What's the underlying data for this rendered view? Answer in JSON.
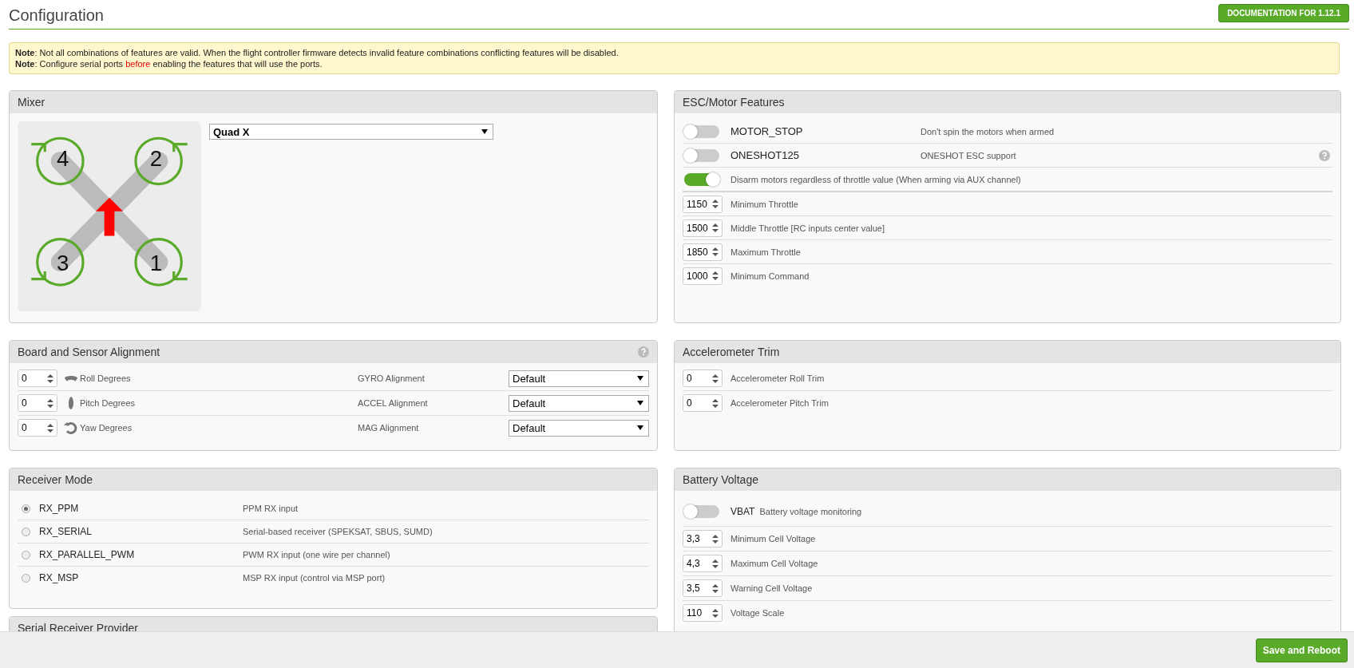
{
  "header": {
    "title": "Configuration",
    "doc_button": "DOCUMENTATION FOR 1.12.1"
  },
  "notes": [
    {
      "segments": [
        {
          "kind": "plain",
          "text": "**Note**: Not all combinations of features are valid. When the flight controller firmware detects invalid feature combinations conflicting features will be disabled."
        }
      ]
    },
    {
      "segments": [
        {
          "kind": "plain",
          "text": "**Note**: Configure serial ports "
        },
        {
          "kind": "warning",
          "text": "before"
        },
        {
          "kind": "plain",
          "text": " enabling the features that will use the ports."
        }
      ]
    }
  ],
  "mixer": {
    "title": "Mixer",
    "type": "Quad X",
    "motors": [
      "4",
      "2",
      "3",
      "1"
    ]
  },
  "esc": {
    "title": "ESC/Motor Features",
    "items": [
      {
        "kind": "toggle",
        "on": false,
        "name": "MOTOR_STOP",
        "description": "Don't spin the motors when armed",
        "help": false
      },
      {
        "kind": "toggle",
        "on": false,
        "name": "ONESHOT125",
        "description": "ONESHOT ESC support",
        "help": true
      },
      {
        "kind": "toggle",
        "on": true,
        "description": "Disarm motors regardless of throttle value (When arming via AUX channel)",
        "help": false
      },
      {
        "kind": "number",
        "value": "1150",
        "label": "Minimum Throttle"
      },
      {
        "kind": "number",
        "value": "1500",
        "label": "Middle Throttle [RC inputs center value]"
      },
      {
        "kind": "number",
        "value": "1850",
        "label": "Maximum Throttle"
      },
      {
        "kind": "number",
        "value": "1000",
        "label": "Minimum Command"
      }
    ]
  },
  "alignment": {
    "title": "Board and Sensor Alignment",
    "help": true,
    "rows": [
      {
        "kind": "roll",
        "value": "0",
        "label": "Roll Degrees",
        "sensor": "GYRO Alignment",
        "option": "Default"
      },
      {
        "kind": "pitch",
        "value": "0",
        "label": "Pitch Degrees",
        "sensor": "ACCEL Alignment",
        "option": "Default"
      },
      {
        "kind": "yaw",
        "value": "0",
        "label": "Yaw Degrees",
        "sensor": "MAG Alignment",
        "option": "Default"
      }
    ]
  },
  "accelerometer_trim": {
    "title": "Accelerometer Trim",
    "rows": [
      {
        "value": "0",
        "label": "Accelerometer Roll Trim"
      },
      {
        "value": "0",
        "label": "Accelerometer Pitch Trim"
      }
    ]
  },
  "receiver_mode": {
    "title": "Receiver Mode",
    "options": [
      {
        "name": "RX_PPM",
        "description": "PPM RX input",
        "selected": true
      },
      {
        "name": "RX_SERIAL",
        "description": "Serial-based receiver (SPEKSAT, SBUS, SUMD)",
        "selected": false
      },
      {
        "name": "RX_PARALLEL_PWM",
        "description": "PWM RX input (one wire per channel)",
        "selected": false
      },
      {
        "name": "RX_MSP",
        "description": "MSP RX input (control via MSP port)",
        "selected": false
      }
    ]
  },
  "battery": {
    "title": "Battery Voltage",
    "toggle": {
      "name": "VBAT",
      "description": "Battery voltage monitoring",
      "on": false
    },
    "rows": [
      {
        "value": "3,3",
        "label": "Minimum Cell Voltage"
      },
      {
        "value": "4,3",
        "label": "Maximum Cell Voltage"
      },
      {
        "value": "3,5",
        "label": "Warning Cell Voltage"
      },
      {
        "value": "110",
        "label": "Voltage Scale"
      }
    ]
  },
  "serial_receiver": {
    "title": "Serial Receiver Provider"
  },
  "footer": {
    "save_button": "Save and Reboot"
  }
}
